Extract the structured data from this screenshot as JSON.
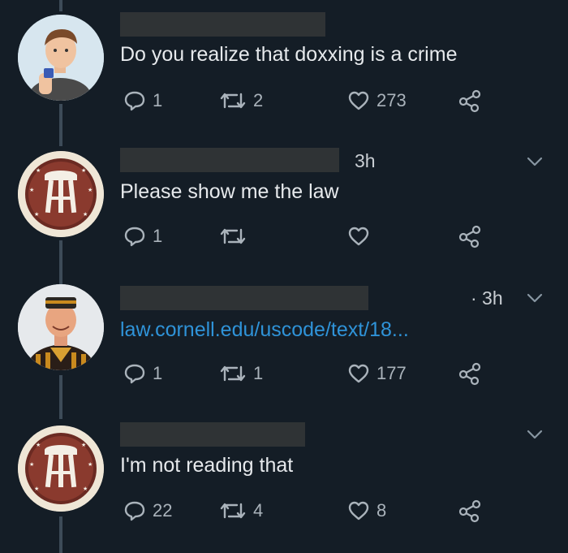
{
  "tweets": [
    {
      "text": "Do you realize that doxxing is a crime",
      "time": "",
      "reply_count": "1",
      "retweet_count": "2",
      "like_count": "273",
      "show_caret": false
    },
    {
      "text": "Please show me the law",
      "time": "3h",
      "reply_count": "1",
      "retweet_count": "",
      "like_count": "",
      "show_caret": true
    },
    {
      "text": "law.cornell.edu/uscode/text/18...",
      "time": "· 3h",
      "reply_count": "1",
      "retweet_count": "1",
      "like_count": "177",
      "show_caret": true
    },
    {
      "text": "I'm not reading that",
      "time": "",
      "reply_count": "22",
      "retweet_count": "4",
      "like_count": "8",
      "show_caret": true
    }
  ],
  "colors": {
    "background": "#141d26",
    "text": "#e6e9ec",
    "link": "#2f93d8",
    "icon": "#aab3bb",
    "redaction": "#2f3335"
  },
  "icons": [
    "reply-icon",
    "retweet-icon",
    "heart-icon",
    "share-icon",
    "chevron-down-icon"
  ]
}
